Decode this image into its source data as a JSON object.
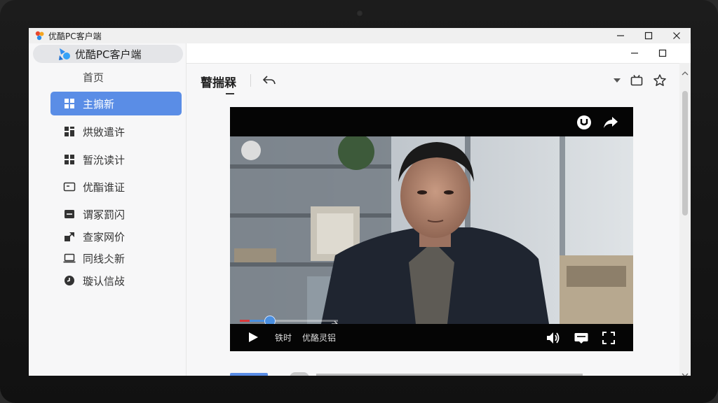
{
  "window": {
    "title": "优酷PC客户端",
    "controls": [
      "minimize-icon",
      "maximize-icon",
      "close-icon"
    ]
  },
  "sidebar": {
    "app_name": "优酷PC客户端",
    "home_label": "首页",
    "items": [
      {
        "label": "主搧新",
        "icon": "grid-icon",
        "active": true
      },
      {
        "label": "烘敓遣许",
        "icon": "grid-alt-icon",
        "active": false
      },
      {
        "label": "暂沇读计",
        "icon": "grid-icon",
        "active": false
      },
      {
        "label": "优酯谁证",
        "icon": "tv-icon",
        "active": false
      },
      {
        "label": "谓冢罰闪",
        "icon": "minus-box-icon",
        "active": false
      },
      {
        "label": "查家网价",
        "icon": "share-box-icon",
        "active": false
      },
      {
        "label": "同线仌新",
        "icon": "laptop-icon",
        "active": false
      },
      {
        "label": "璇认信敁",
        "icon": "clock-icon",
        "active": false
      }
    ]
  },
  "toolbar": {
    "title": "瞽揣槑",
    "back_icon": "back-arrow-icon",
    "right_icons": [
      "dropdown-arrow-icon",
      "screen-icon",
      "star-icon"
    ]
  },
  "player": {
    "top_icons": [
      "youku-icon",
      "share-arrow-icon"
    ],
    "time_label": "铁时",
    "brand_label": "优酪灵铝",
    "progress": 0.1,
    "buffered": 0.25,
    "control_icons": [
      "play-icon",
      "volume-icon",
      "subtitle-icon",
      "fullscreen-icon"
    ]
  },
  "colors": {
    "accent": "#5a8de6",
    "progress_played": "#d9393b",
    "progress_handle": "#4a8fe0"
  }
}
